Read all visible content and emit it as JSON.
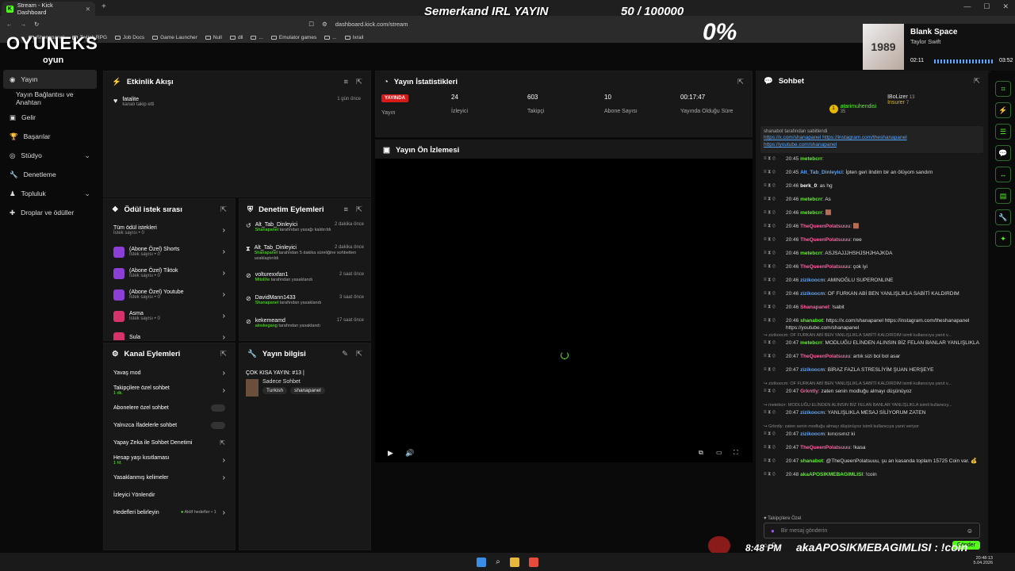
{
  "browser": {
    "tab_title": "Stream - Kick Dashboard",
    "url": "dashboard.kick.com/stream",
    "bookmarks": [
      "Shanapanel",
      "Twitch RPG",
      "Job Docs",
      "Game Launcher",
      "Null",
      "dll",
      "...",
      "Emulator games",
      "...",
      "Ixrail"
    ]
  },
  "overlay": {
    "title": "Semerkand IRL YAYIN",
    "goal": "50 / 100000",
    "percent": "0%",
    "brand": "OYUNEKS",
    "brand_sub": "oyun",
    "clock": "8:48 PM",
    "ticker": "akaAPOSIKMEBAGIMLISI : !coin",
    "music": {
      "title": "Blank Space",
      "artist": "Taylor Swift",
      "elapsed": "02:11",
      "total": "03:52",
      "album_label": "1989"
    }
  },
  "sidebar": {
    "items": [
      {
        "label": "Yayın",
        "icon": "broadcast-icon",
        "active": true
      },
      {
        "label": "Yayın Bağlantısı ve Anahtarı",
        "icon": "",
        "active": false
      },
      {
        "label": "Gelir",
        "icon": "money-icon"
      },
      {
        "label": "Başarılar",
        "icon": "trophy-icon"
      },
      {
        "label": "Stüdyo",
        "icon": "studio-icon",
        "chevron": true
      },
      {
        "label": "Denetleme",
        "icon": "wrench-icon"
      },
      {
        "label": "Topluluk",
        "icon": "people-icon",
        "chevron": true
      },
      {
        "label": "Droplar ve ödüller",
        "icon": "gift-icon"
      }
    ]
  },
  "activity": {
    "title": "Etkinlik Akışı",
    "items": [
      {
        "user": "fatalite",
        "desc": "kanalı takip etti",
        "time": "1 gün önce"
      }
    ]
  },
  "stats": {
    "title": "Yayın İstatistikleri",
    "live_badge": "YAYINDA",
    "items": [
      {
        "value": "",
        "label": "Yayın"
      },
      {
        "value": "24",
        "label": "İzleyici"
      },
      {
        "value": "603",
        "label": "Takipçi"
      },
      {
        "value": "10",
        "label": "Abone Sayısı"
      },
      {
        "value": "00:17:47",
        "label": "Yayında Olduğu Süre"
      }
    ]
  },
  "preview": {
    "title": "Yayın Ön İzlemesi"
  },
  "rewards": {
    "title": "Ödül istek sırası",
    "items": [
      {
        "name": "Tüm ödül istekleri",
        "sub": "İstek sayısı • 0"
      },
      {
        "name": "(Abone Özel) Shorts",
        "sub": "İstek sayısı • 0"
      },
      {
        "name": "(Abone Özel) Tiktok",
        "sub": "İstek sayısı • 0"
      },
      {
        "name": "(Abone Özel) Youtube",
        "sub": "İstek sayısı • 0"
      },
      {
        "name": "Asma",
        "sub": "İstek sayısı • 0"
      },
      {
        "name": "Sula",
        "sub": ""
      }
    ]
  },
  "modactions": {
    "title": "Denetim Eylemleri",
    "items": [
      {
        "user": "Alt_Tab_Dinleyici",
        "actor": "Shanapanel",
        "desc": "tarafından yasağı kaldırıldı",
        "time": "2 dakika önce"
      },
      {
        "user": "Alt_Tab_Dinleyici",
        "actor": "Shanapanel",
        "desc": "tarafından 5 dakika süreliğine sohbetten uzaklaştırıldı",
        "time": "2 dakika önce"
      },
      {
        "user": "volturexxfan1",
        "actor": "Mitoll/w",
        "desc": "tarafından yasaklandı",
        "time": "2 saat önce"
      },
      {
        "user": "DavidMann1433",
        "actor": "Shanapanel",
        "desc": "tarafından yasaklandı",
        "time": "3 saat önce"
      },
      {
        "user": "kekemeamd",
        "actor": "aloskegang",
        "desc": "tarafından yasaklandı",
        "time": "17 saat önce"
      }
    ]
  },
  "channel": {
    "title": "Kanal Eylemleri",
    "items": [
      {
        "label": "Yavaş mod",
        "sub": "",
        "ctl": "arrow"
      },
      {
        "label": "Takipçilere özel sohbet",
        "sub": "1 dk.",
        "ctl": "arrow"
      },
      {
        "label": "Abonelere özel sohbet",
        "sub": "",
        "ctl": "toggle"
      },
      {
        "label": "Yalnızca İfadelerle sohbet",
        "sub": "",
        "ctl": "toggle"
      },
      {
        "label": "Yapay Zeka ile Sohbet Denetimi",
        "sub": "",
        "ctl": "ext"
      },
      {
        "label": "Hesap yaşı kısıtlaması",
        "sub": "1 hf.",
        "ctl": "arrow"
      },
      {
        "label": "Yasaklanmış kelimeler",
        "sub": "",
        "ctl": "arrow"
      },
      {
        "label": "İzleyici Yönlendir",
        "sub": "",
        "ctl": ""
      },
      {
        "label": "Hedefleri belirleyin",
        "sub": "",
        "ctl": "arrow",
        "extra": "Aktif hedefler • 1"
      }
    ]
  },
  "streaminfo": {
    "title": "Yayın bilgisi",
    "stream_title": "ÇOK KISA YAYIN: #13 |",
    "category": "Sadece Sohbet",
    "tags": [
      "Turkish",
      "shanapanel"
    ]
  },
  "chat": {
    "title": "Sohbet",
    "top": [
      {
        "name": "atarimuhendisi",
        "count": "35"
      },
      {
        "name": "IBoLizer",
        "count": "13"
      },
      {
        "name": "İnsurer",
        "count": "7"
      }
    ],
    "pinned_by": "shanabot tarafından sabitlendi",
    "pinned_text": "https://x.com/shanapanel https://instagram.com/theshanapanel https://youtube.com/shanapanel",
    "messages": [
      {
        "time": "20:45",
        "user": "metebcrr",
        "color": "green",
        "text": ""
      },
      {
        "time": "20:45",
        "user": "Alt_Tab_Dinleyici",
        "color": "blue",
        "text": "İpten geri ilndim bir an ölüyom sandım"
      },
      {
        "time": "20:46",
        "user": "berk_0",
        "color": "white",
        "text": "as hg"
      },
      {
        "time": "20:46",
        "user": "metebcrr",
        "color": "green",
        "text": "As"
      },
      {
        "time": "20:46",
        "user": "metebcrr",
        "color": "green",
        "text": "🟫"
      },
      {
        "time": "20:46",
        "user": "TheQueenPolatsuuu",
        "color": "pink",
        "text": "🟫"
      },
      {
        "time": "20:46",
        "user": "TheQueenPolatsuuu",
        "color": "pink",
        "text": "nee"
      },
      {
        "time": "20:46",
        "user": "metebcrr",
        "color": "green",
        "text": "ASJSAJJJHSHJSHJHAJKDA"
      },
      {
        "time": "20:46",
        "user": "TheQueenPolatsuuu",
        "color": "pink",
        "text": "çok iyi"
      },
      {
        "time": "20:46",
        "user": "zizikoocm",
        "color": "blue",
        "text": "AMINOĞLU SUPERONLINE"
      },
      {
        "time": "20:46",
        "user": "zizikoocm",
        "color": "blue",
        "text": "OF FURKAN ABİ BEN YANLIŞLIKLA SABİTİ KALDIRDIM"
      },
      {
        "time": "20:46",
        "user": "Shanapanel",
        "color": "pink",
        "text": "!sabit"
      },
      {
        "time": "20:46",
        "user": "shanabot",
        "color": "green",
        "text": "https://x.com/shanapanel https://instagram.com/theshanapanel https://youtube.com/shanapanel"
      },
      {
        "sys": "zizikoocm: OF FURKAN ABİ BEN YANLIŞLIKLA SABİTİ KALDIRDIM isimli kullanıcıya yanıt v..."
      },
      {
        "time": "20:47",
        "user": "metebcrr",
        "color": "green",
        "text": "MODLUĞU ELİNDEN ALINSIN BİZ FELAN BANLAR YANLIŞLIKLA"
      },
      {
        "time": "20:47",
        "user": "TheQueenPolatsuuu",
        "color": "pink",
        "text": "artık sizi bol bol asar"
      },
      {
        "time": "20:47",
        "user": "zizikoocm",
        "color": "blue",
        "text": "BİRAZ FAZLA STRESLİYİM ŞUAN HERŞEYE"
      },
      {
        "sys": "zizikoocm: OF FURKAN ABİ BEN YANLIŞLIKLA SABİTİ KALDIRDIM isimli kullanıcıya yanıt v..."
      },
      {
        "time": "20:47",
        "user": "Grkntly",
        "color": "pink",
        "text": "zaten senin modluğu almayı düşünüyoz"
      },
      {
        "sys": "metebcrr: MODLUĞU ELİNDEN ALINSIN BİZ FELAN BANLAR YANLIŞLIKLA isimli kullanıcıy..."
      },
      {
        "time": "20:47",
        "user": "zizikoocm",
        "color": "blue",
        "text": "YANLIŞLIKLA MESAJ SİLİYORUM ZATEN"
      },
      {
        "sys": "Grkntly: zaten senin modluğu almayı düşünüyoz isimli kullanıcıya yanıt veriyor"
      },
      {
        "time": "20:47",
        "user": "zizikoocm",
        "color": "blue",
        "text": "kırıcısınız ki"
      },
      {
        "time": "20:47",
        "user": "TheQueenPolatsuuu",
        "color": "pink",
        "text": "!kasa"
      },
      {
        "time": "20:47",
        "user": "shanabot",
        "color": "green",
        "text": "@TheQueenPolatsuuu, şu an kasanda toplam 15725 Coin var. 💰"
      },
      {
        "time": "20:48",
        "user": "akaAPOSIKMEBAGIMLISI",
        "color": "green",
        "text": "!coin"
      }
    ],
    "followers_only": "Takipçilere Özel",
    "input_placeholder": "Bir mesaj gönderin",
    "count": "0",
    "send_label": "Gönder"
  },
  "taskbar": {
    "time": "20:48:13",
    "date": "5.04.2026"
  }
}
